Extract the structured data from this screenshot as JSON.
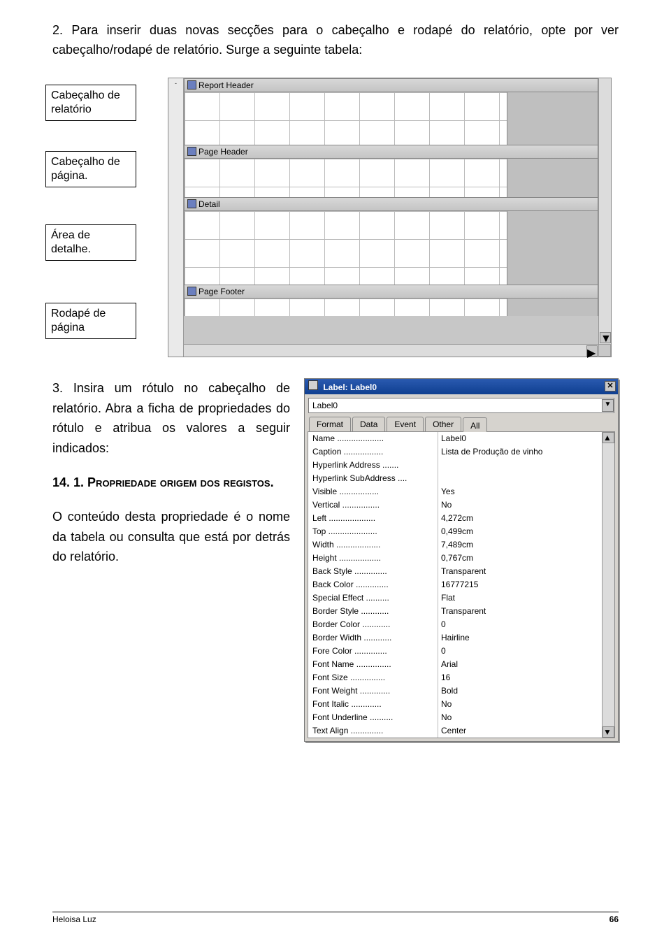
{
  "intro": "2. Para inserir duas novas secções para o cabeçalho e rodapé do relatório, opte por ver cabeçalho/rodapé de relatório. Surge a seguinte tabela:",
  "callouts": {
    "c1": "Cabeçalho de relatório",
    "c2": "Cabeçalho de página.",
    "c3": "Área de detalhe.",
    "c4": "Rodapé de página"
  },
  "sections": {
    "report_header": "Report Header",
    "page_header": "Page Header",
    "detail": "Detail",
    "page_footer": "Page Footer"
  },
  "step3": {
    "p1": "3. Insira um rótulo no cabeçalho de relatório. Abra a ficha de propriedades do rótulo e atribua os valores a seguir indicados:",
    "h1_lead": "14. 1. ",
    "h1_caps": "Propriedade origem dos registos.",
    "p2": "O conteúdo desta propriedade é o nome da tabela ou consulta que está por detrás do relatório."
  },
  "prop_window": {
    "title": "Label: Label0",
    "combo": "Label0",
    "tabs": [
      "Format",
      "Data",
      "Event",
      "Other",
      "All"
    ],
    "rows": [
      {
        "k": "Name",
        "v": "Label0"
      },
      {
        "k": "Caption",
        "v": "Lista de Produção de vinho"
      },
      {
        "k": "Hyperlink Address",
        "v": ""
      },
      {
        "k": "Hyperlink SubAddress",
        "v": ""
      },
      {
        "k": "Visible",
        "v": "Yes"
      },
      {
        "k": "Vertical",
        "v": "No"
      },
      {
        "k": "Left",
        "v": "4,272cm"
      },
      {
        "k": "Top",
        "v": "0,499cm"
      },
      {
        "k": "Width",
        "v": "7,489cm"
      },
      {
        "k": "Height",
        "v": "0,767cm"
      },
      {
        "k": "Back Style",
        "v": "Transparent"
      },
      {
        "k": "Back Color",
        "v": "16777215"
      },
      {
        "k": "Special Effect",
        "v": "Flat"
      },
      {
        "k": "Border Style",
        "v": "Transparent"
      },
      {
        "k": "Border Color",
        "v": "0"
      },
      {
        "k": "Border Width",
        "v": "Hairline"
      },
      {
        "k": "Fore Color",
        "v": "0"
      },
      {
        "k": "Font Name",
        "v": "Arial"
      },
      {
        "k": "Font Size",
        "v": "16"
      },
      {
        "k": "Font Weight",
        "v": "Bold"
      },
      {
        "k": "Font Italic",
        "v": "No"
      },
      {
        "k": "Font Underline",
        "v": "No"
      },
      {
        "k": "Text Align",
        "v": "Center"
      }
    ]
  },
  "footer": {
    "author": "Heloisa Luz",
    "page": "66"
  }
}
